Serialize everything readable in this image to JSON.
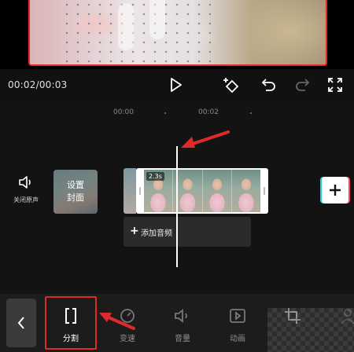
{
  "player": {
    "current_time": "00:02",
    "total_time": "00:03",
    "time_display": "00:02/00:03"
  },
  "timeline": {
    "ruler_labels": [
      "00:00",
      "00:02"
    ],
    "mute_label": "关闭原声",
    "cover_label_line1": "设置",
    "cover_label_line2": "封面",
    "clip_speed": "2.3s",
    "add_audio_label": "添加音频",
    "add_audio_icon": "+",
    "add_clip_icon": "+"
  },
  "toolbar": {
    "back_icon": "chevron-left-icon",
    "tools": [
      {
        "label": "分割",
        "icon": "split-icon"
      },
      {
        "label": "变速",
        "icon": "speed-icon"
      },
      {
        "label": "音量",
        "icon": "volume-icon"
      },
      {
        "label": "动画",
        "icon": "animation-icon"
      },
      {
        "label": "",
        "icon": "crop-icon"
      },
      {
        "label": "",
        "icon": "person-icon"
      }
    ]
  },
  "colors": {
    "annotation_red": "#e02a2a",
    "toolbar_bg": "#1c1c1c",
    "timeline_bg": "#131313"
  }
}
